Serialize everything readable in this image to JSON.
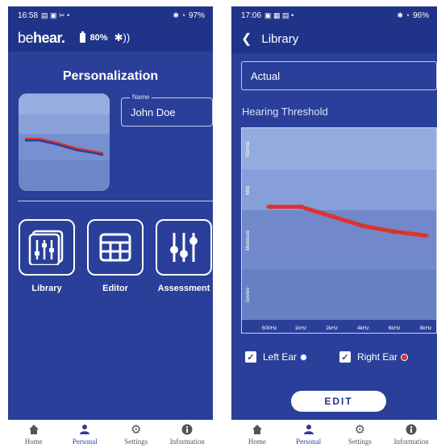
{
  "left": {
    "status": {
      "time": "16:58",
      "left_glyphs": "▤ ▣ ✂ •",
      "right_glyphs": "✱ ◔",
      "battery": "97%"
    },
    "brand": {
      "be": "be",
      "hear": "hear."
    },
    "device": {
      "battery": "80%",
      "bt_glyph": "✱))"
    },
    "title": "Personalization",
    "name_field": {
      "legend": "Name",
      "value": "John Doe"
    },
    "tiles": [
      {
        "label": "Library",
        "icon": "library-icon"
      },
      {
        "label": "Editor",
        "icon": "grid-icon"
      },
      {
        "label": "Assessment",
        "icon": "sliders-icon"
      }
    ]
  },
  "right": {
    "status": {
      "time": "17:06",
      "left_glyphs": "▣ ▦ ▤ •",
      "right_glyphs": "✱ ◔",
      "battery": "96%"
    },
    "appbar_title": "Library",
    "select_value": "Actual",
    "section_title": "Hearing Threshold",
    "checks": {
      "left": "Left Ear",
      "right": "Right Ear"
    },
    "edit_label": "EDIT"
  },
  "nav": [
    {
      "label": "Home",
      "icon": "home-icon"
    },
    {
      "label": "Personal",
      "icon": "person-icon"
    },
    {
      "label": "Settings",
      "icon": "gear-icon"
    },
    {
      "label": "Information",
      "icon": "info-icon"
    }
  ],
  "colors": {
    "primary": "#2a3f99",
    "appbar": "#1f3489",
    "curve": "#e0312b",
    "left_ear": "#1f5fff",
    "right_ear": "#e0312b"
  },
  "chart_data": {
    "type": "line",
    "title": "Hearing Threshold",
    "categories": [
      "500Hz",
      "1kHz",
      "2kHz",
      "4kHz",
      "6kHz",
      "8kHz"
    ],
    "bands": [
      "Normal",
      "Mild",
      "Moderate",
      "Severe"
    ],
    "points": [
      {
        "x": "500Hz",
        "y": 41
      },
      {
        "x": "1kHz",
        "y": 41
      },
      {
        "x": "2kHz",
        "y": 46
      },
      {
        "x": "4kHz",
        "y": 51
      },
      {
        "x": "6kHz",
        "y": 54
      },
      {
        "x": "8kHz",
        "y": 56
      }
    ],
    "ylim": [
      0,
      100
    ],
    "legend": "bottom"
  }
}
